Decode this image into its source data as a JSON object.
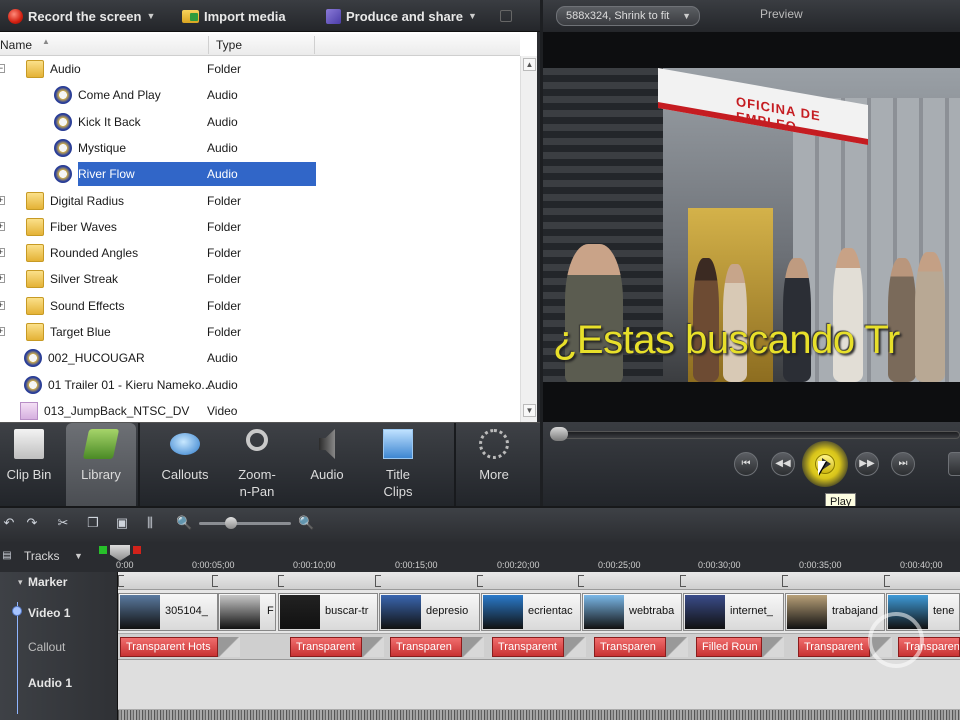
{
  "toolbar": {
    "record": "Record the screen",
    "import": "Import media",
    "produce": "Produce and share"
  },
  "file_list": {
    "columns": {
      "name": "Name",
      "type": "Type"
    },
    "rows": [
      {
        "name": "Audio",
        "type": "Folder",
        "icon": "folder-icon"
      },
      {
        "name": "Come And Play",
        "type": "Audio",
        "icon": "audio-icon"
      },
      {
        "name": "Kick It Back",
        "type": "Audio",
        "icon": "audio-icon"
      },
      {
        "name": "Mystique",
        "type": "Audio",
        "icon": "audio-icon"
      },
      {
        "name": "River Flow",
        "type": "Audio",
        "icon": "audio-icon",
        "selected": true
      },
      {
        "name": "Digital Radius",
        "type": "Folder",
        "icon": "folder-icon"
      },
      {
        "name": "Fiber Waves",
        "type": "Folder",
        "icon": "folder-icon"
      },
      {
        "name": "Rounded Angles",
        "type": "Folder",
        "icon": "folder-icon"
      },
      {
        "name": "Silver Streak",
        "type": "Folder",
        "icon": "folder-icon"
      },
      {
        "name": "Sound Effects",
        "type": "Folder",
        "icon": "folder-icon"
      },
      {
        "name": "Target Blue",
        "type": "Folder",
        "icon": "folder-icon"
      },
      {
        "name": "002_HUCOUGAR",
        "type": "Audio",
        "icon": "audio-icon"
      },
      {
        "name": "01 Trailer 01 - Kieru Nameko...",
        "type": "Audio",
        "icon": "audio-icon"
      },
      {
        "name": "013_JumpBack_NTSC_DV",
        "type": "Video",
        "icon": "video-icon"
      }
    ]
  },
  "tabs": [
    {
      "label": "Clip Bin",
      "icon": "clip-bin-icon"
    },
    {
      "label": "Library",
      "icon": "library-icon",
      "active": true
    },
    {
      "label": "Callouts",
      "icon": "callouts-icon"
    },
    {
      "label": "Zoom-n-Pan",
      "icon": "zoom-icon"
    },
    {
      "label": "Audio",
      "icon": "speaker-icon"
    },
    {
      "label": "Title Clips",
      "icon": "title-clips-icon"
    },
    {
      "label": "More",
      "icon": "more-icon"
    }
  ],
  "preview": {
    "size_dropdown": "588x324, Shrink to fit",
    "title": "Preview",
    "sign_text": "OFICINA DE EMPLEO",
    "subtitle": "¿Estas buscando Tr",
    "tooltip": "Play"
  },
  "timeline": {
    "tracks_label": "Tracks",
    "ruler_ticks": [
      "0:00",
      "0:00:05;00",
      "0:00:10;00",
      "0:00:15;00",
      "0:00:20;00",
      "0:00:25;00",
      "0:00:30;00",
      "0:00:35;00",
      "0:00:40;00"
    ],
    "track_names": {
      "marker": "Marker",
      "video": "Video 1",
      "callout": "Callout",
      "audio": "Audio 1"
    },
    "video_clips": [
      "305104_",
      "F",
      "buscar-tr",
      "depresio",
      "ecrientac",
      "webtraba",
      "internet_",
      "trabajand",
      "tene"
    ],
    "callouts": [
      "Transparent Hots",
      "Transparent",
      "Transparen",
      "Transparent",
      "Transparen",
      "Filled Roun",
      "Transparent",
      "Transparent"
    ]
  },
  "colors": {
    "accent_selection": "#3166c8",
    "callout_red": "#c83232",
    "subtitle_yellow": "#e8e02a",
    "play_yellow": "#f6ec3a"
  }
}
